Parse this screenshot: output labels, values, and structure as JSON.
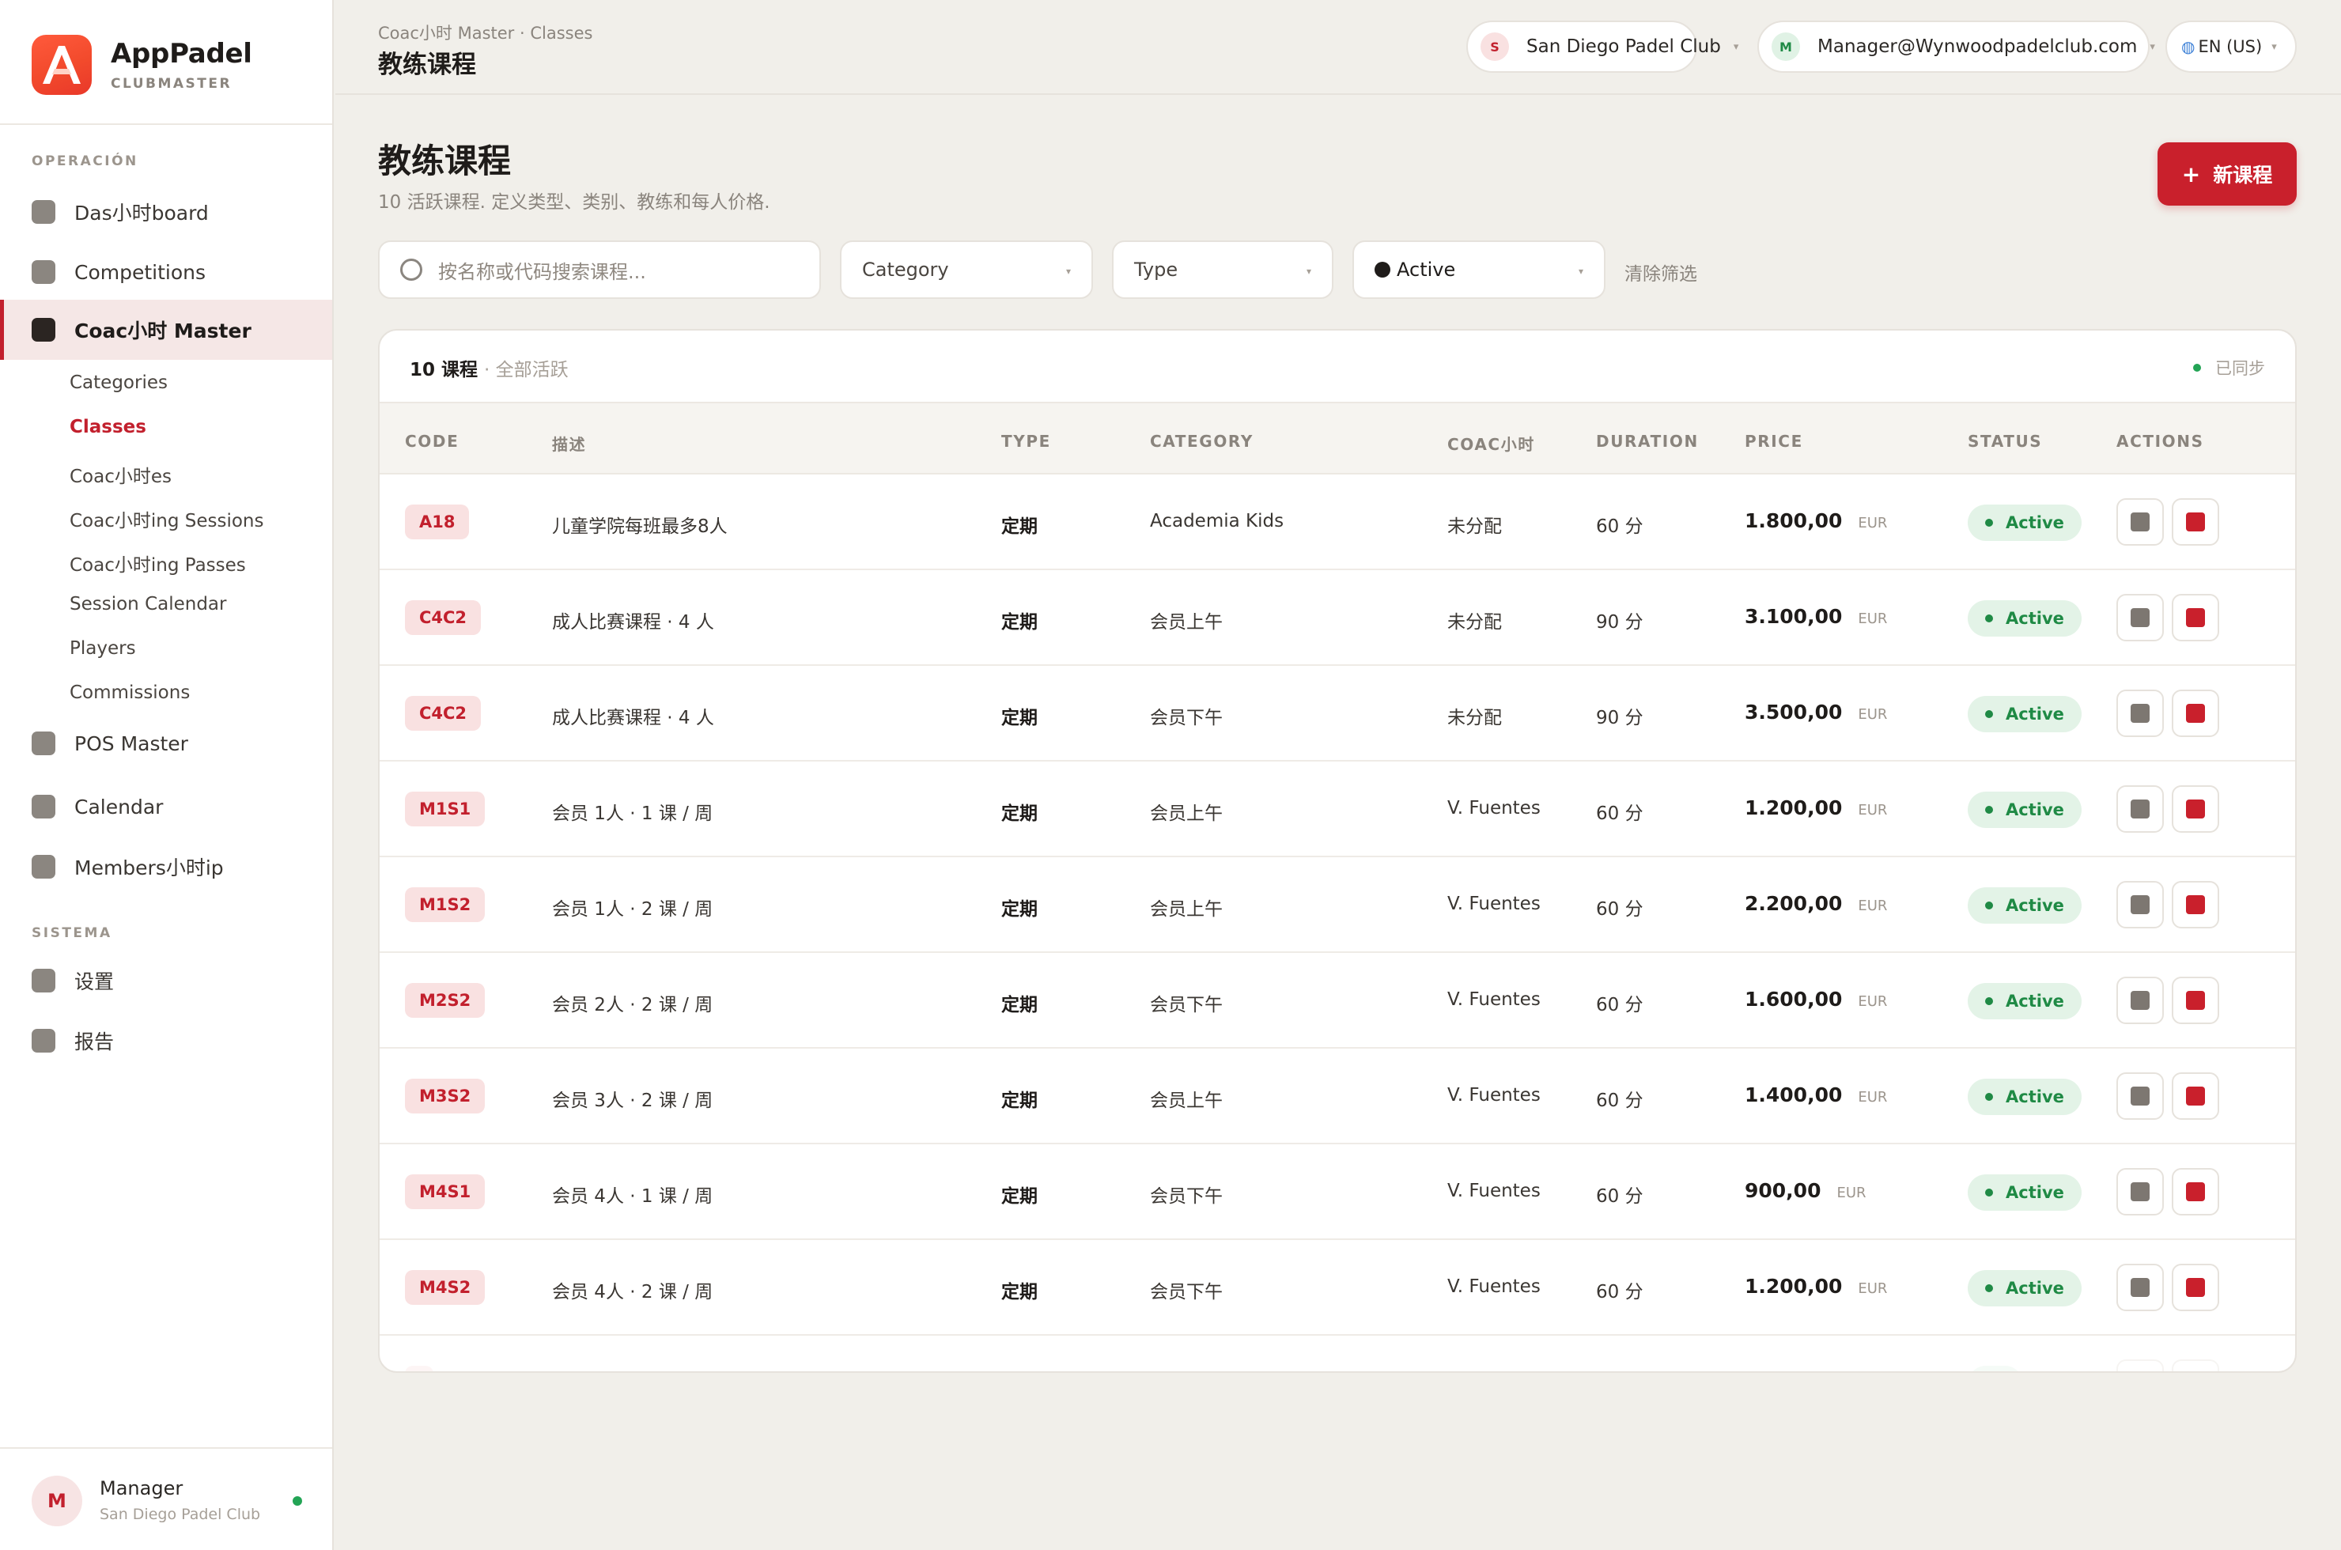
{
  "brand": {
    "title": "AppPadel",
    "subtitle": "CLUBMASTER"
  },
  "sidebar": {
    "section_operacion": "OPERACIÓN",
    "section_sistema": "SISTEMA",
    "items": [
      {
        "label": "Das小时board"
      },
      {
        "label": "Competitions"
      },
      {
        "label": "Coac小时 Master"
      },
      {
        "label": "POS Master"
      },
      {
        "label": "Calendar"
      },
      {
        "label": "Members小时ip"
      },
      {
        "label": "设置"
      },
      {
        "label": "报告"
      }
    ],
    "subitems": [
      {
        "label": "Categories"
      },
      {
        "label": "Classes"
      },
      {
        "label": "Coac小时es"
      },
      {
        "label": "Coac小时ing Sessions"
      },
      {
        "label": "Coac小时ing Passes"
      },
      {
        "label": "Session Calendar"
      },
      {
        "label": "Players"
      },
      {
        "label": "Commissions"
      }
    ],
    "user": {
      "initial": "M",
      "name": "Manager",
      "club": "San Diego Padel Club"
    }
  },
  "header": {
    "breadcrumb": "Coac小时 Master · Classes",
    "title": "教练课程",
    "club_initial": "S",
    "club_name": "San Diego Padel Club",
    "manager_initial": "M",
    "manager_email": "Manager@Wynwoodpadelclub.com",
    "language": "EN (US)"
  },
  "page": {
    "title": "教练课程",
    "subtitle": "10 活跃课程. 定义类型、类别、教练和每人价格.",
    "new_button": "新课程"
  },
  "filters": {
    "search_placeholder": "按名称或代码搜索课程...",
    "category": "Category",
    "type": "Type",
    "status": "Active",
    "clear": "清除筛选"
  },
  "table": {
    "count": "10 课程",
    "count_sub": "· 全部活跃",
    "sync": "已同步",
    "headers": {
      "code": "CODE",
      "desc": "描述",
      "type": "TYPE",
      "category": "CATEGORY",
      "coach": "COAC小时",
      "duration": "DURATION",
      "price": "PRICE",
      "status": "STATUS",
      "actions": "ACTIONS"
    },
    "rows": [
      {
        "code": "A18",
        "desc": "儿童学院每班最多8人",
        "type": "定期",
        "category": "Academia Kids",
        "coach": "未分配",
        "duration": "60 分",
        "price": "1.800,00",
        "currency": "EUR",
        "status": "Active"
      },
      {
        "code": "C4C2",
        "desc": "成人比赛课程 · 4 人",
        "type": "定期",
        "category": "会员上午",
        "coach": "未分配",
        "duration": "90 分",
        "price": "3.100,00",
        "currency": "EUR",
        "status": "Active"
      },
      {
        "code": "C4C2",
        "desc": "成人比赛课程 · 4 人",
        "type": "定期",
        "category": "会员下午",
        "coach": "未分配",
        "duration": "90 分",
        "price": "3.500,00",
        "currency": "EUR",
        "status": "Active"
      },
      {
        "code": "M1S1",
        "desc": "会员 1人 · 1 课 / 周",
        "type": "定期",
        "category": "会员上午",
        "coach": "V. Fuentes",
        "duration": "60 分",
        "price": "1.200,00",
        "currency": "EUR",
        "status": "Active"
      },
      {
        "code": "M1S2",
        "desc": "会员 1人 · 2 课 / 周",
        "type": "定期",
        "category": "会员上午",
        "coach": "V. Fuentes",
        "duration": "60 分",
        "price": "2.200,00",
        "currency": "EUR",
        "status": "Active"
      },
      {
        "code": "M2S2",
        "desc": "会员 2人 · 2 课 / 周",
        "type": "定期",
        "category": "会员下午",
        "coach": "V. Fuentes",
        "duration": "60 分",
        "price": "1.600,00",
        "currency": "EUR",
        "status": "Active"
      },
      {
        "code": "M3S2",
        "desc": "会员 3人 · 2 课 / 周",
        "type": "定期",
        "category": "会员上午",
        "coach": "V. Fuentes",
        "duration": "60 分",
        "price": "1.400,00",
        "currency": "EUR",
        "status": "Active"
      },
      {
        "code": "M4S1",
        "desc": "会员 4人 · 1 课 / 周",
        "type": "定期",
        "category": "会员下午",
        "coach": "V. Fuentes",
        "duration": "60 分",
        "price": "900,00",
        "currency": "EUR",
        "status": "Active"
      },
      {
        "code": "M4S2",
        "desc": "会员 4人 · 2 课 / 周",
        "type": "定期",
        "category": "会员下午",
        "coach": "V. Fuentes",
        "duration": "60 分",
        "price": "1.200,00",
        "currency": "EUR",
        "status": "Active"
      }
    ]
  },
  "colors": {
    "accent": "#c9202c",
    "success": "#1f8a45",
    "background": "#f1efea"
  }
}
